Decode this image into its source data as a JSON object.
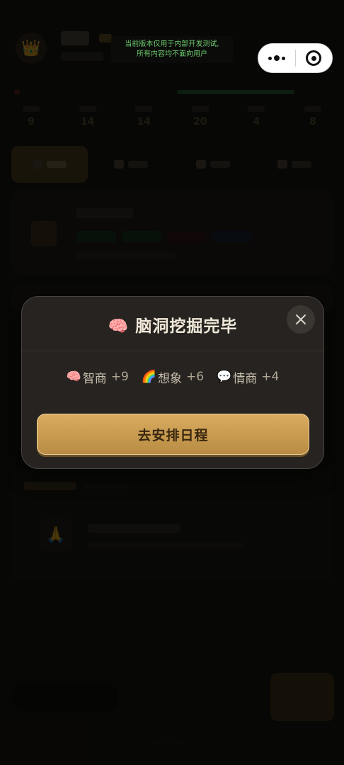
{
  "system": {
    "notice_line1": "当前版本仅用于内部开发测试,",
    "notice_line2": "所有内容均不面向用户"
  },
  "background": {
    "stats": [
      "9",
      "14",
      "14",
      "20",
      "4",
      "8"
    ]
  },
  "modal": {
    "title_icon": "🧠",
    "title": "脑洞挖掘完毕",
    "rewards": [
      {
        "icon": "🧠",
        "label": "智商",
        "amount": "+9"
      },
      {
        "icon": "🌈",
        "label": "想象",
        "amount": "+6"
      },
      {
        "icon": "💬",
        "label": "情商",
        "amount": "+4"
      }
    ],
    "primary_button": "去安排日程"
  },
  "colors": {
    "overlay": "#000000",
    "modal_bg": "#262320",
    "button_gold": "#c79a4f",
    "button_text": "#3a2710",
    "title_text": "#f1e9da",
    "notice_text": "#6ccc6c"
  }
}
